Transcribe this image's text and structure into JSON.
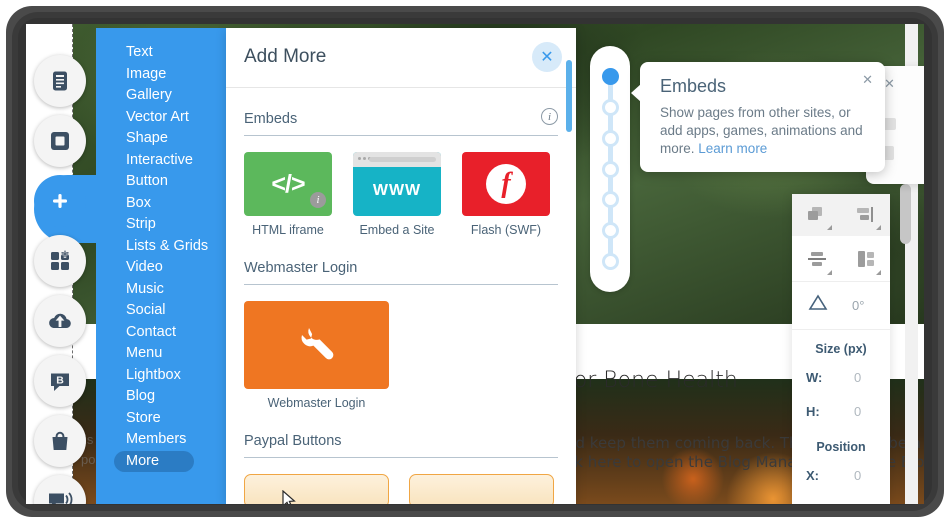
{
  "rail": {
    "items": [
      {
        "name": "pages-icon",
        "label": "Pages",
        "active": false
      },
      {
        "name": "background-icon",
        "label": "Background",
        "active": false
      },
      {
        "name": "add-icon",
        "label": "Add",
        "active": true
      },
      {
        "name": "app-market-icon",
        "label": "App Market",
        "active": false
      },
      {
        "name": "upload-icon",
        "label": "My Uploads",
        "active": false
      },
      {
        "name": "blog-icon",
        "label": "Blog",
        "active": false
      },
      {
        "name": "store-icon",
        "label": "Store",
        "active": false
      },
      {
        "name": "chat-icon",
        "label": "Chat",
        "active": false
      }
    ]
  },
  "categories": {
    "items": [
      {
        "label": "Text",
        "selected": false
      },
      {
        "label": "Image",
        "selected": false
      },
      {
        "label": "Gallery",
        "selected": false
      },
      {
        "label": "Vector Art",
        "selected": false
      },
      {
        "label": "Shape",
        "selected": false
      },
      {
        "label": "Interactive",
        "selected": false
      },
      {
        "label": "Button",
        "selected": false
      },
      {
        "label": "Box",
        "selected": false
      },
      {
        "label": "Strip",
        "selected": false
      },
      {
        "label": "Lists & Grids",
        "selected": false
      },
      {
        "label": "Video",
        "selected": false
      },
      {
        "label": "Music",
        "selected": false
      },
      {
        "label": "Social",
        "selected": false
      },
      {
        "label": "Contact",
        "selected": false
      },
      {
        "label": "Menu",
        "selected": false
      },
      {
        "label": "Lightbox",
        "selected": false
      },
      {
        "label": "Blog",
        "selected": false
      },
      {
        "label": "Store",
        "selected": false
      },
      {
        "label": "Members",
        "selected": false
      },
      {
        "label": "More",
        "selected": true
      }
    ]
  },
  "dialog": {
    "title": "Add More",
    "close_label": "✕",
    "sections": [
      {
        "heading": "Embeds",
        "has_info": true,
        "info_label": "i",
        "tiles": [
          {
            "caption": "HTML iframe",
            "art": "code",
            "art_text": "</>",
            "color": "#5cb85c",
            "badge": "i"
          },
          {
            "caption": "Embed a Site",
            "art": "browser",
            "art_text": "WWW",
            "color": "#16b3c6"
          },
          {
            "caption": "Flash (SWF)",
            "art": "flash",
            "art_text": "f",
            "color": "#e8202a"
          }
        ]
      },
      {
        "heading": "Webmaster Login",
        "has_info": false,
        "tiles": [
          {
            "caption": "Webmaster Login",
            "art": "wrench",
            "color": "#ef7622"
          }
        ]
      },
      {
        "heading": "Paypal Buttons",
        "has_info": false,
        "tiles": [
          {
            "caption": "",
            "art": "paypal",
            "color": "#f0a644"
          },
          {
            "caption": "",
            "art": "paypal",
            "color": "#f0a644"
          }
        ]
      }
    ]
  },
  "tooltip": {
    "title": "Embeds",
    "body": "Show pages from other sites, or add apps, games, animations and more.",
    "link": "Learn more",
    "close_label": "✕"
  },
  "right_panel": {
    "back_close_label": "✕",
    "tools": [
      {
        "name": "arrange-icon"
      },
      {
        "name": "align-horizontal-icon"
      },
      {
        "name": "distribute-vertical-icon"
      },
      {
        "name": "align-vertical-icon"
      }
    ],
    "rotation_label": "0°",
    "size_heading": "Size (px)",
    "width_key": "W:",
    "width_value": "0",
    "height_key": "H:",
    "height_value": "0",
    "position_heading": "Position",
    "x_key": "X:",
    "x_value": "0"
  },
  "stepper": {
    "dots": 7,
    "active_index": 0
  },
  "canvas": {
    "heading": "for Bone Health",
    "paragraph1": "nd keep them coming back. They can also be a grea",
    "paragraph2": "ck here to open the Blog Manager. From the Blog M",
    "faint1": "is i",
    "faint2": "posi"
  },
  "colors": {
    "accent": "#3899ec",
    "accent_dark": "#2b7cc4",
    "heading": "#4a6377",
    "green": "#5cb85c",
    "teal": "#16b3c6",
    "red": "#e8202a",
    "orange": "#ef7622"
  }
}
